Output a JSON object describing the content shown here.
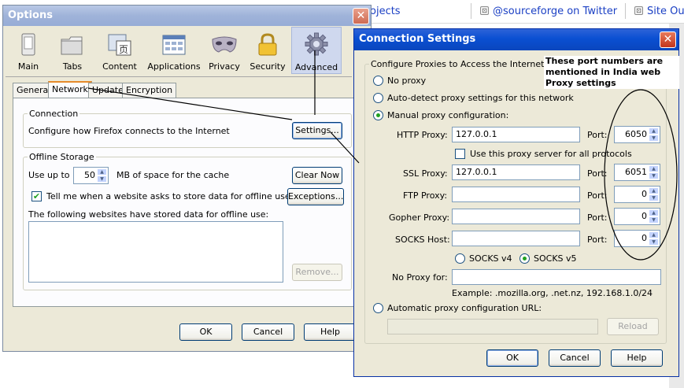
{
  "background": {
    "links": [
      "ojects",
      "@sourceforge on Twitter",
      "Site Out"
    ]
  },
  "options_dialog": {
    "title": "Options",
    "close_glyph": "✕",
    "toolbar": [
      {
        "label": "Main",
        "icon": "switch-icon"
      },
      {
        "label": "Tabs",
        "icon": "folder-icon"
      },
      {
        "label": "Content",
        "icon": "content-icon"
      },
      {
        "label": "Applications",
        "icon": "applications-icon"
      },
      {
        "label": "Privacy",
        "icon": "mask-icon"
      },
      {
        "label": "Security",
        "icon": "lock-icon"
      },
      {
        "label": "Advanced",
        "icon": "gear-icon",
        "active": true
      }
    ],
    "tabs": [
      "General",
      "Network",
      "Update",
      "Encryption"
    ],
    "selected_tab": "Network",
    "connection": {
      "title": "Connection",
      "text": "Configure how Firefox connects to the Internet",
      "settings_button": "Settings..."
    },
    "offline": {
      "title": "Offline Storage",
      "use_up_to": "Use up to",
      "cache_value": "50",
      "cache_suffix": "MB of space for the cache",
      "clear_now": "Clear Now",
      "tell_me_label": "Tell me when a website asks to store data for offline use",
      "tell_me_checked": true,
      "exceptions": "Exceptions...",
      "stored_label": "The following websites have stored data for offline use:",
      "remove": "Remove..."
    },
    "buttons": {
      "ok": "OK",
      "cancel": "Cancel",
      "help": "Help"
    }
  },
  "connection_dialog": {
    "title": "Connection Settings",
    "close_glyph": "✕",
    "group_title": "Configure Proxies to Access the Internet",
    "annotation": "These port numbers are mentioned in India web Proxy settings",
    "options": {
      "no_proxy": "No proxy",
      "auto_detect": "Auto-detect proxy settings for this network",
      "manual": "Manual proxy configuration:",
      "selected": "manual"
    },
    "http_proxy": {
      "label": "HTTP Proxy:",
      "value": "127.0.0.1",
      "port_label": "Port:",
      "port": "6050"
    },
    "use_for_all": {
      "label": "Use this proxy server for all protocols",
      "checked": false
    },
    "ssl_proxy": {
      "label": "SSL Proxy:",
      "value": "127.0.0.1",
      "port_label": "Port:",
      "port": "6051"
    },
    "ftp_proxy": {
      "label": "FTP Proxy:",
      "value": "",
      "port_label": "Port:",
      "port": "0"
    },
    "gopher_proxy": {
      "label": "Gopher Proxy:",
      "value": "",
      "port_label": "Port:",
      "port": "0"
    },
    "socks_host": {
      "label": "SOCKS Host:",
      "value": "",
      "port_label": "Port:",
      "port": "0"
    },
    "socks_v4": "SOCKS v4",
    "socks_v5": "SOCKS v5",
    "socks_selected": "v5",
    "no_proxy_for": {
      "label": "No Proxy for:",
      "value": ""
    },
    "example": "Example: .mozilla.org, .net.nz, 192.168.1.0/24",
    "auto_config": {
      "label": "Automatic proxy configuration URL:",
      "value": "",
      "reload": "Reload"
    },
    "buttons": {
      "ok": "OK",
      "cancel": "Cancel",
      "help": "Help"
    }
  }
}
